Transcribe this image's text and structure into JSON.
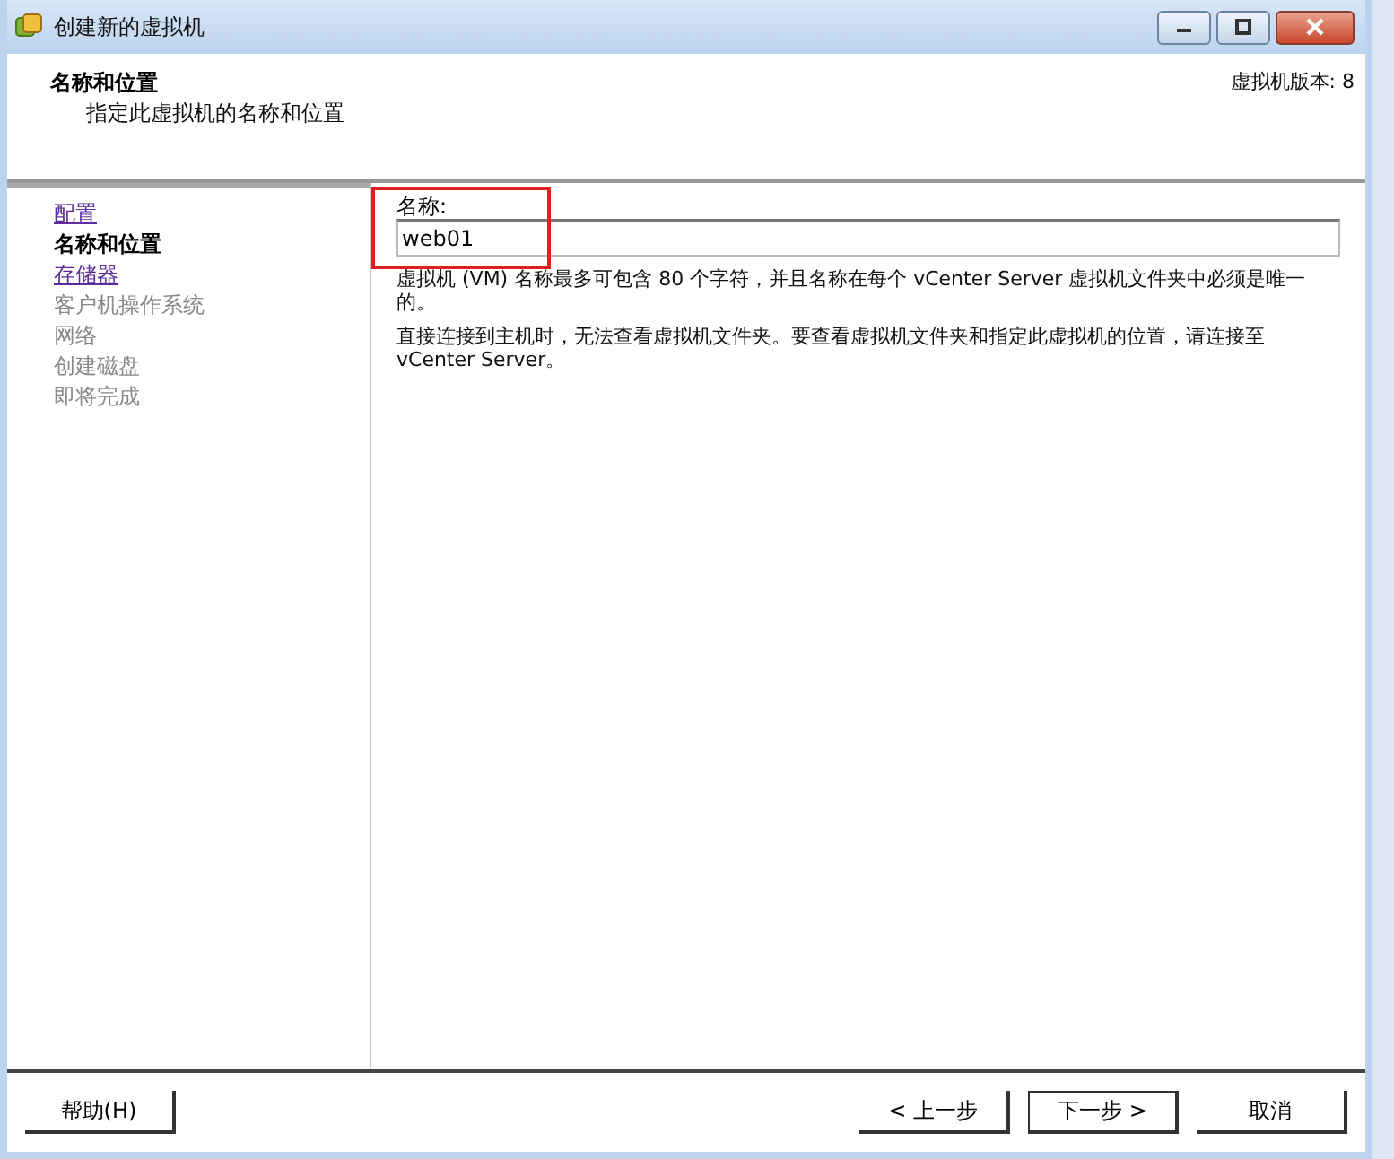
{
  "window": {
    "title": "创建新的虚拟机"
  },
  "header": {
    "title": "名称和位置",
    "subtitle": "指定此虚拟机的名称和位置",
    "version": "虚拟机版本: 8"
  },
  "steps": [
    {
      "label": "配置",
      "kind": "link"
    },
    {
      "label": "名称和位置",
      "kind": "current"
    },
    {
      "label": "存储器",
      "kind": "link"
    },
    {
      "label": "客户机操作系统",
      "kind": "disabled"
    },
    {
      "label": "网络",
      "kind": "disabled"
    },
    {
      "label": "创建磁盘",
      "kind": "disabled"
    },
    {
      "label": "即将完成",
      "kind": "disabled"
    }
  ],
  "name_field": {
    "label": "名称:",
    "value": "web01",
    "highlighted": true
  },
  "notes": [
    "虚拟机 (VM) 名称最多可包含 80 个字符，并且名称在每个 vCenter Server 虚拟机文件夹中必须是唯一的。",
    "直接连接到主机时，无法查看虚拟机文件夹。要查看虚拟机文件夹和指定此虚拟机的位置，请连接至 vCenter Server。"
  ],
  "buttons": {
    "help": "帮助(H)",
    "back": "< 上一步",
    "next": "下一步 >",
    "cancel": "取消"
  }
}
